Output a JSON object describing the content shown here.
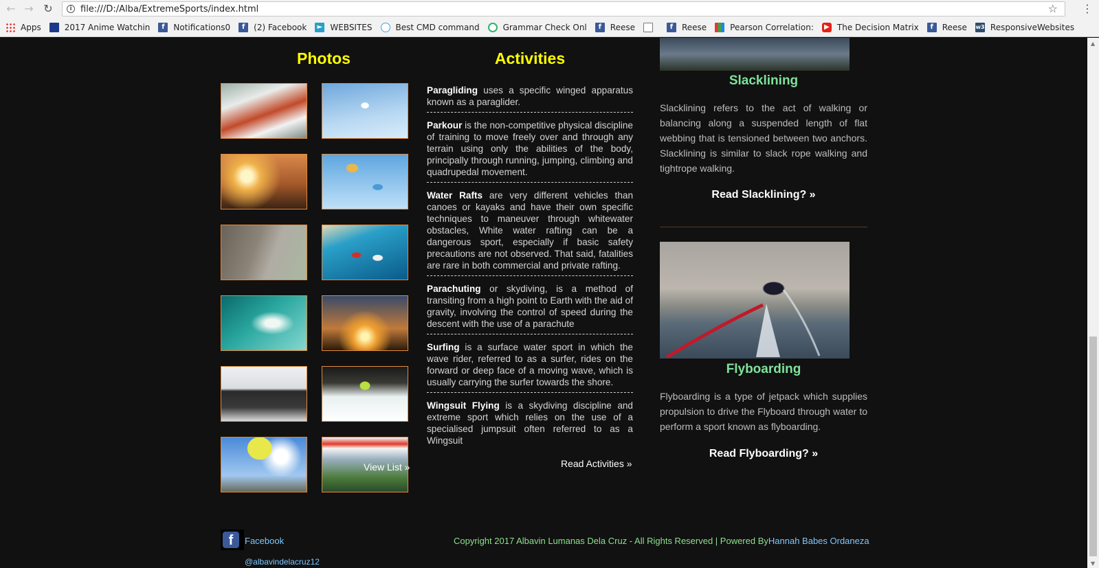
{
  "browser": {
    "url": "file:///D:/Alba/ExtremeSports/index.html",
    "bookmarks": [
      {
        "label": "Apps",
        "icon": "apps-grid-icon"
      },
      {
        "label": "2017 Anime Watchin",
        "icon": "sirl-icon"
      },
      {
        "label": "Notifications0",
        "icon": "facebook-icon"
      },
      {
        "label": "(2) Facebook",
        "icon": "facebook-icon"
      },
      {
        "label": "WEBSITES",
        "icon": "websites-icon"
      },
      {
        "label": "Best CMD command",
        "icon": "cmd-icon"
      },
      {
        "label": "Grammar Check Onl",
        "icon": "grammar-icon"
      },
      {
        "label": "Reese",
        "icon": "facebook-icon"
      },
      {
        "label": "",
        "icon": "document-icon"
      },
      {
        "label": "Reese",
        "icon": "facebook-icon"
      },
      {
        "label": "Pearson Correlation:",
        "icon": "chart-icon"
      },
      {
        "label": "The Decision Matrix",
        "icon": "youtube-icon"
      },
      {
        "label": "Reese",
        "icon": "facebook-icon"
      },
      {
        "label": "ResponsiveWebsites",
        "icon": "w3-icon"
      }
    ]
  },
  "photos": {
    "heading": "Photos",
    "view_list": "View List »",
    "thumbs": [
      "rafting-photo",
      "hang-gliding-photo",
      "hiker-sunset-photo",
      "parachutes-photo",
      "rock-climbing-photo",
      "wingsuit-photo",
      "surfing-photo",
      "jump-sunset-photo",
      "cyclists-photo",
      "kayak-waterfall-photo",
      "paraglider-photo",
      "zipline-photo"
    ]
  },
  "activities": {
    "heading": "Activities",
    "items": [
      {
        "name": "Paragliding",
        "text": " uses a specific winged apparatus known as a paraglider."
      },
      {
        "name": "Parkour",
        "text": " is the non-competitive physical discipline of training to move freely over and through any terrain using only the abilities of the body, principally through running, jumping, climbing and quadrupedal movement."
      },
      {
        "name": "Water Rafts",
        "text": " are very different vehicles than canoes or kayaks and have their own specific techniques to maneuver through whitewater obstacles, White water rafting can be a dangerous sport, especially if basic safety precautions are not observed. That said, fatalities are rare in both commercial and private rafting."
      },
      {
        "name": "Parachuting",
        "text": " or skydiving, is a method of transiting from a high point to Earth with the aid of gravity, involving the control of speed during the descent with the use of a parachute"
      },
      {
        "name": "Surfing",
        "text": " is a surface water sport in which the wave rider, referred to as a surfer, rides on the forward or deep face of a moving wave, which is usually carrying the surfer towards the shore."
      },
      {
        "name": "Wingsuit Flying",
        "text": " is a skydiving discipline and extreme sport which relies on the use of a specialised jumpsuit often referred to as a Wingsuit"
      }
    ],
    "read_more": "Read Activities »"
  },
  "slacklining": {
    "title": "Slacklining",
    "desc": "Slacklining refers to the act of walking or balancing along a suspended length of flat webbing that is tensioned between two anchors. Slacklining is similar to slack rope walking and tightrope walking.",
    "link": "Read Slacklining? »"
  },
  "flyboarding": {
    "title": "Flyboarding",
    "desc": "Flyboarding is a type of jetpack which supplies propulsion to drive the Flyboard through water to perform a sport known as flyboarding.",
    "link": "Read Flyboarding? »"
  },
  "footer": {
    "facebook_label": "Facebook",
    "facebook_handle": "@albavindelacruz12",
    "copyright": "Copyright 2017 Albavin Lumanas Dela Cruz - All Rights Reserved | Powered By",
    "powered_by": "Hannah Babes Ordaneza"
  }
}
